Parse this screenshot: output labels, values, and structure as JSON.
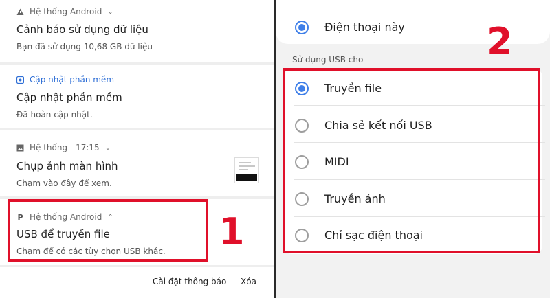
{
  "notifications": [
    {
      "app": "Hệ thống Android",
      "title": "Cảnh báo sử dụng dữ liệu",
      "body": "Bạn đã sử dụng 10,68 GB dữ liệu"
    },
    {
      "app": "Cập nhật phần mềm",
      "title": "Cập nhật phần mềm",
      "body": "Đã hoàn cập nhật."
    },
    {
      "app": "Hệ thống",
      "time": "17:15",
      "title": "Chụp ảnh màn hình",
      "body": "Chạm vào đây để xem."
    },
    {
      "app": "Hệ thống Android",
      "title": "USB để truyền file",
      "body": "Chạm để có các tùy chọn USB khác."
    }
  ],
  "footer": {
    "settings_label": "Cài đặt thông báo",
    "clear_label": "Xóa"
  },
  "annotations": {
    "step1": "1",
    "step2": "2"
  },
  "usb": {
    "top_option": "Điện thoại này",
    "section_label": "Sử dụng USB cho",
    "options": [
      {
        "label": "Truyền file",
        "selected": true
      },
      {
        "label": "Chia sẻ kết nối USB",
        "selected": false
      },
      {
        "label": "MIDI",
        "selected": false
      },
      {
        "label": "Truyền ảnh",
        "selected": false
      },
      {
        "label": "Chỉ sạc điện thoại",
        "selected": false
      }
    ]
  },
  "colors": {
    "highlight": "#e0102a",
    "radio_selected": "#3f7fe8",
    "link_blue": "#2f6fd6"
  },
  "icons": {
    "warning": "warning-icon",
    "update": "software-update-icon",
    "image": "image-icon",
    "usb_p": "usb-p-icon"
  }
}
